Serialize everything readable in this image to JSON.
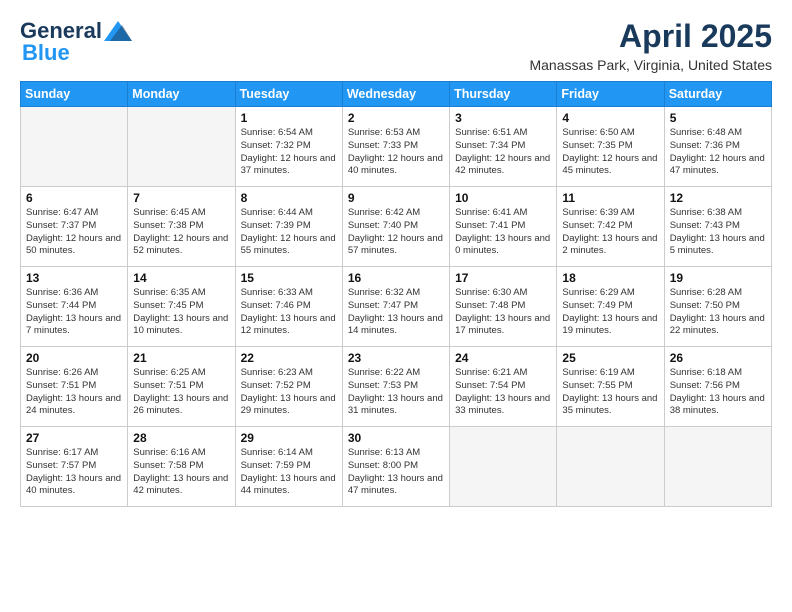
{
  "header": {
    "logo_general": "General",
    "logo_blue": "Blue",
    "title": "April 2025",
    "subtitle": "Manassas Park, Virginia, United States"
  },
  "days_of_week": [
    "Sunday",
    "Monday",
    "Tuesday",
    "Wednesday",
    "Thursday",
    "Friday",
    "Saturday"
  ],
  "weeks": [
    [
      {
        "day": "",
        "info": ""
      },
      {
        "day": "",
        "info": ""
      },
      {
        "day": "1",
        "info": "Sunrise: 6:54 AM\nSunset: 7:32 PM\nDaylight: 12 hours and 37 minutes."
      },
      {
        "day": "2",
        "info": "Sunrise: 6:53 AM\nSunset: 7:33 PM\nDaylight: 12 hours and 40 minutes."
      },
      {
        "day": "3",
        "info": "Sunrise: 6:51 AM\nSunset: 7:34 PM\nDaylight: 12 hours and 42 minutes."
      },
      {
        "day": "4",
        "info": "Sunrise: 6:50 AM\nSunset: 7:35 PM\nDaylight: 12 hours and 45 minutes."
      },
      {
        "day": "5",
        "info": "Sunrise: 6:48 AM\nSunset: 7:36 PM\nDaylight: 12 hours and 47 minutes."
      }
    ],
    [
      {
        "day": "6",
        "info": "Sunrise: 6:47 AM\nSunset: 7:37 PM\nDaylight: 12 hours and 50 minutes."
      },
      {
        "day": "7",
        "info": "Sunrise: 6:45 AM\nSunset: 7:38 PM\nDaylight: 12 hours and 52 minutes."
      },
      {
        "day": "8",
        "info": "Sunrise: 6:44 AM\nSunset: 7:39 PM\nDaylight: 12 hours and 55 minutes."
      },
      {
        "day": "9",
        "info": "Sunrise: 6:42 AM\nSunset: 7:40 PM\nDaylight: 12 hours and 57 minutes."
      },
      {
        "day": "10",
        "info": "Sunrise: 6:41 AM\nSunset: 7:41 PM\nDaylight: 13 hours and 0 minutes."
      },
      {
        "day": "11",
        "info": "Sunrise: 6:39 AM\nSunset: 7:42 PM\nDaylight: 13 hours and 2 minutes."
      },
      {
        "day": "12",
        "info": "Sunrise: 6:38 AM\nSunset: 7:43 PM\nDaylight: 13 hours and 5 minutes."
      }
    ],
    [
      {
        "day": "13",
        "info": "Sunrise: 6:36 AM\nSunset: 7:44 PM\nDaylight: 13 hours and 7 minutes."
      },
      {
        "day": "14",
        "info": "Sunrise: 6:35 AM\nSunset: 7:45 PM\nDaylight: 13 hours and 10 minutes."
      },
      {
        "day": "15",
        "info": "Sunrise: 6:33 AM\nSunset: 7:46 PM\nDaylight: 13 hours and 12 minutes."
      },
      {
        "day": "16",
        "info": "Sunrise: 6:32 AM\nSunset: 7:47 PM\nDaylight: 13 hours and 14 minutes."
      },
      {
        "day": "17",
        "info": "Sunrise: 6:30 AM\nSunset: 7:48 PM\nDaylight: 13 hours and 17 minutes."
      },
      {
        "day": "18",
        "info": "Sunrise: 6:29 AM\nSunset: 7:49 PM\nDaylight: 13 hours and 19 minutes."
      },
      {
        "day": "19",
        "info": "Sunrise: 6:28 AM\nSunset: 7:50 PM\nDaylight: 13 hours and 22 minutes."
      }
    ],
    [
      {
        "day": "20",
        "info": "Sunrise: 6:26 AM\nSunset: 7:51 PM\nDaylight: 13 hours and 24 minutes."
      },
      {
        "day": "21",
        "info": "Sunrise: 6:25 AM\nSunset: 7:51 PM\nDaylight: 13 hours and 26 minutes."
      },
      {
        "day": "22",
        "info": "Sunrise: 6:23 AM\nSunset: 7:52 PM\nDaylight: 13 hours and 29 minutes."
      },
      {
        "day": "23",
        "info": "Sunrise: 6:22 AM\nSunset: 7:53 PM\nDaylight: 13 hours and 31 minutes."
      },
      {
        "day": "24",
        "info": "Sunrise: 6:21 AM\nSunset: 7:54 PM\nDaylight: 13 hours and 33 minutes."
      },
      {
        "day": "25",
        "info": "Sunrise: 6:19 AM\nSunset: 7:55 PM\nDaylight: 13 hours and 35 minutes."
      },
      {
        "day": "26",
        "info": "Sunrise: 6:18 AM\nSunset: 7:56 PM\nDaylight: 13 hours and 38 minutes."
      }
    ],
    [
      {
        "day": "27",
        "info": "Sunrise: 6:17 AM\nSunset: 7:57 PM\nDaylight: 13 hours and 40 minutes."
      },
      {
        "day": "28",
        "info": "Sunrise: 6:16 AM\nSunset: 7:58 PM\nDaylight: 13 hours and 42 minutes."
      },
      {
        "day": "29",
        "info": "Sunrise: 6:14 AM\nSunset: 7:59 PM\nDaylight: 13 hours and 44 minutes."
      },
      {
        "day": "30",
        "info": "Sunrise: 6:13 AM\nSunset: 8:00 PM\nDaylight: 13 hours and 47 minutes."
      },
      {
        "day": "",
        "info": ""
      },
      {
        "day": "",
        "info": ""
      },
      {
        "day": "",
        "info": ""
      }
    ]
  ]
}
